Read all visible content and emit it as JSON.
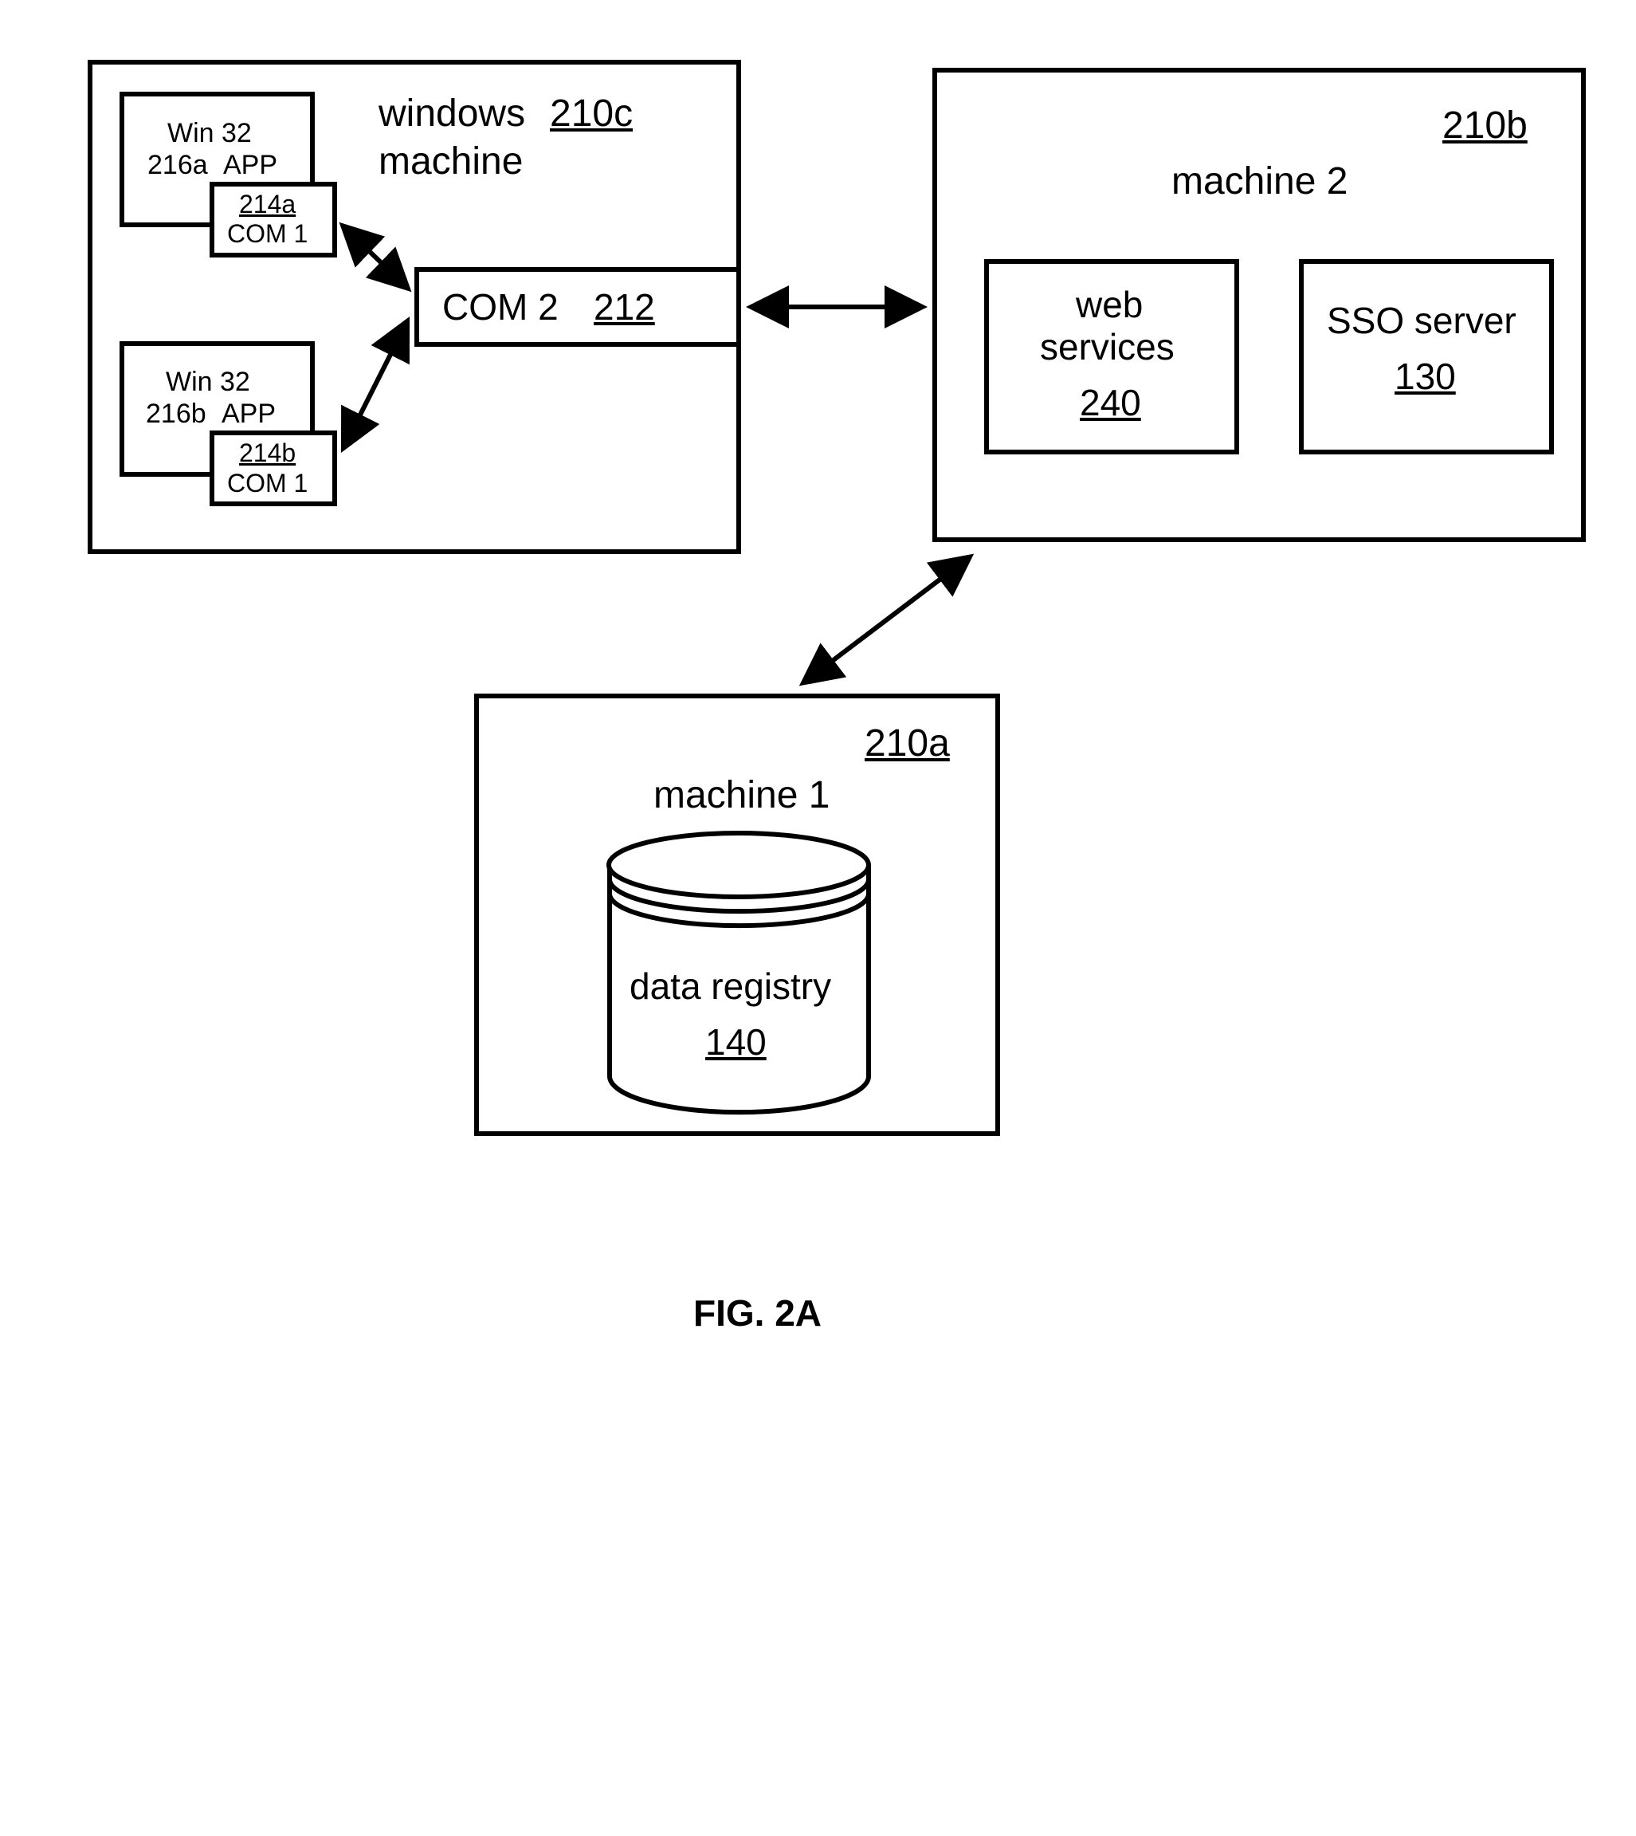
{
  "figure_caption": "FIG. 2A",
  "windows_machine": {
    "title": "windows",
    "title2": "machine",
    "ref": "210c",
    "app_a": {
      "line1": "Win 32",
      "line2_ref": "216a",
      "line2_txt": "APP"
    },
    "app_b": {
      "line1": "Win 32",
      "line2_ref": "216b",
      "line2_txt": "APP"
    },
    "com1_a": {
      "ref": "214a",
      "label": "COM 1"
    },
    "com1_b": {
      "ref": "214b",
      "label": "COM 1"
    },
    "com2": {
      "label": "COM 2",
      "ref": "212"
    }
  },
  "machine2": {
    "title": "machine 2",
    "ref": "210b",
    "web_services": {
      "label1": "web",
      "label2": "services",
      "ref": "240"
    },
    "sso": {
      "label": "SSO server",
      "ref": "130"
    }
  },
  "machine1": {
    "title": "machine 1",
    "ref": "210a",
    "registry": {
      "label": "data registry",
      "ref": "140"
    }
  }
}
